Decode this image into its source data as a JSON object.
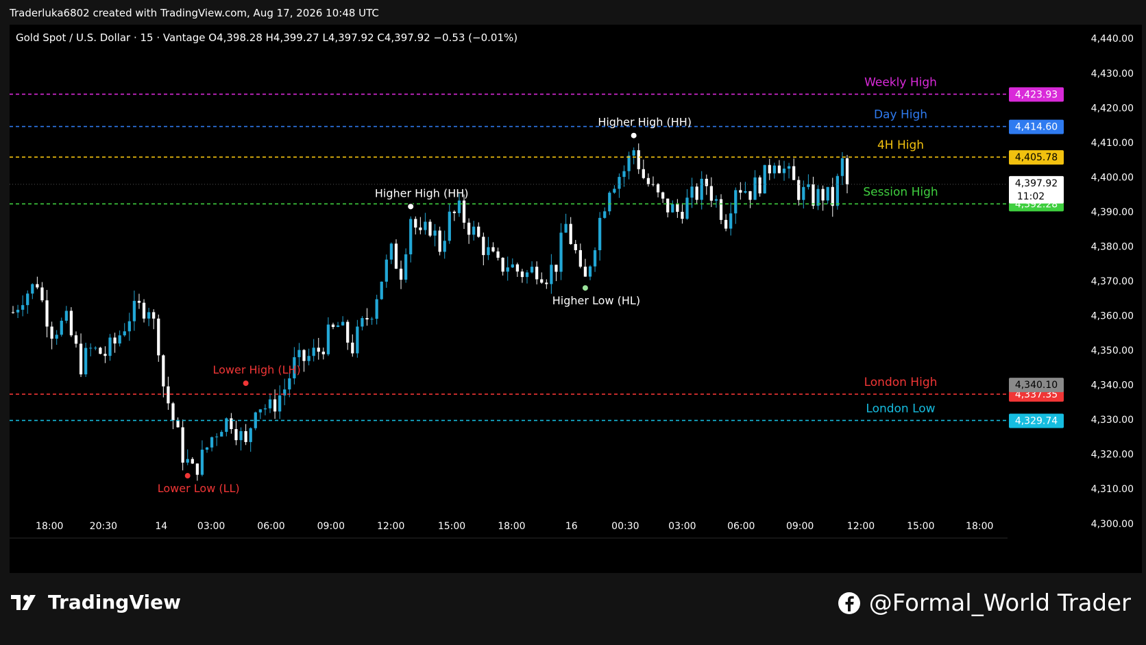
{
  "header": {
    "credit": "Traderluka6802 created with TradingView.com, Aug 17, 2026 10:48 UTC"
  },
  "chart_data": {
    "type": "candlestick",
    "title": "Gold Spot / U.S. Dollar · 15 · Vantage",
    "ohlc_text": "O4,398.28  H4,399.27  L4,397.92  C4,397.92  −0.53 (−0.01%)",
    "ylim": [
      4296,
      4444
    ],
    "y_ticks": [
      4300,
      4310,
      4320,
      4330,
      4340,
      4350,
      4360,
      4370,
      4380,
      4390,
      4400,
      4410,
      4420,
      4430,
      4440
    ],
    "y_tick_labels": [
      "4,300.00",
      "4,310.00",
      "4,320.00",
      "4,330.00",
      "4,340.00",
      "4,350.00",
      "4,360.00",
      "4,370.00",
      "4,380.00",
      "4,390.00",
      "4,400.00",
      "4,410.00",
      "4,420.00",
      "4,430.00",
      "4,440.00"
    ],
    "x_ticks": [
      "18:00",
      "20:30",
      "14",
      "03:00",
      "06:00",
      "09:00",
      "12:00",
      "15:00",
      "18:00",
      "16",
      "00:30",
      "03:00",
      "06:00",
      "09:00",
      "12:00",
      "15:00",
      "18:00"
    ],
    "x_tick_pos": [
      0.04,
      0.094,
      0.152,
      0.202,
      0.262,
      0.322,
      0.382,
      0.443,
      0.503,
      0.563,
      0.617,
      0.674,
      0.733,
      0.792,
      0.853,
      0.913,
      0.972
    ],
    "levels": [
      {
        "name": "Weekly High",
        "price": 4423.93,
        "label": "4,423.93",
        "color": "#d92ad9"
      },
      {
        "name": "Day High",
        "price": 4414.6,
        "label": "4,414.60",
        "color": "#2f7bf0"
      },
      {
        "name": "4H High",
        "price": 4405.78,
        "label": "4,405.78",
        "color": "#f2c10f"
      },
      {
        "name": "Session High",
        "price": 4392.28,
        "label": "4,392.28",
        "color": "#3fcf3f"
      },
      {
        "name": "London High",
        "price": 4337.35,
        "label": "4,337.35",
        "color": "#f03636"
      },
      {
        "name": "London Low",
        "price": 4329.74,
        "label": "4,329.74",
        "color": "#16bde0"
      }
    ],
    "extra_tag": {
      "label": "4,340.10",
      "price": 4340.1,
      "color": "#8a8a8a"
    },
    "last_price": {
      "price": 4397.92,
      "label": "4,397.92",
      "countdown": "11:02"
    },
    "annotations": [
      {
        "text": "Higher High (HH)",
        "kind": "high",
        "index": 128,
        "price": 4412.0,
        "color": "#ffffff",
        "dot": "#ffffff"
      },
      {
        "text": "Higher High (HH)",
        "kind": "high",
        "index": 82,
        "price": 4391.5,
        "color": "#ffffff",
        "dot": "#ffffff"
      },
      {
        "text": "Higher Low (HL)",
        "kind": "low",
        "index": 118,
        "price": 4368.0,
        "color": "#ffffff",
        "dot": "#9be39b"
      },
      {
        "text": "Lower High (LH)",
        "kind": "high",
        "index": 48,
        "price": 4340.5,
        "color": "#f03636",
        "dot": "#f03636"
      },
      {
        "text": "Lower Low (LL)",
        "kind": "low",
        "index": 36,
        "price": 4313.8,
        "color": "#f03636",
        "dot": "#f03636"
      }
    ],
    "candles_anchor": [
      [
        0,
        4361
      ],
      [
        2,
        4366
      ],
      [
        4,
        4368
      ],
      [
        5,
        4370
      ],
      [
        6,
        4364
      ],
      [
        8,
        4356
      ],
      [
        11,
        4358
      ],
      [
        14,
        4346
      ],
      [
        16,
        4350
      ],
      [
        19,
        4349
      ],
      [
        21,
        4352
      ],
      [
        24,
        4360
      ],
      [
        26,
        4362
      ],
      [
        28,
        4363
      ],
      [
        30,
        4352
      ],
      [
        31,
        4340
      ],
      [
        33,
        4330
      ],
      [
        35,
        4320
      ],
      [
        37,
        4315
      ],
      [
        39,
        4319
      ],
      [
        41,
        4325
      ],
      [
        43,
        4329
      ],
      [
        45,
        4330
      ],
      [
        47,
        4325
      ],
      [
        48,
        4322
      ],
      [
        50,
        4335
      ],
      [
        53,
        4333
      ],
      [
        56,
        4339
      ],
      [
        58,
        4346
      ],
      [
        61,
        4348
      ],
      [
        63,
        4350
      ],
      [
        65,
        4354
      ],
      [
        67,
        4357
      ],
      [
        70,
        4351
      ],
      [
        72,
        4357
      ],
      [
        74,
        4362
      ],
      [
        76,
        4371
      ],
      [
        78,
        4378
      ],
      [
        80,
        4373
      ],
      [
        82,
        4389
      ],
      [
        84,
        4382
      ],
      [
        86,
        4386
      ],
      [
        88,
        4380
      ],
      [
        90,
        4388
      ],
      [
        92,
        4390
      ],
      [
        94,
        4386
      ],
      [
        96,
        4382
      ],
      [
        98,
        4378
      ],
      [
        100,
        4374
      ],
      [
        102,
        4375
      ],
      [
        104,
        4373
      ],
      [
        106,
        4372
      ],
      [
        108,
        4374
      ],
      [
        110,
        4372
      ],
      [
        112,
        4375
      ],
      [
        114,
        4386
      ],
      [
        116,
        4378
      ],
      [
        117,
        4371
      ],
      [
        118,
        4370
      ],
      [
        121,
        4388
      ],
      [
        123,
        4398
      ],
      [
        126,
        4402
      ],
      [
        128,
        4408
      ],
      [
        130,
        4400
      ],
      [
        132,
        4396
      ],
      [
        134,
        4392
      ],
      [
        137,
        4390
      ],
      [
        140,
        4394
      ],
      [
        143,
        4398
      ],
      [
        145,
        4393
      ],
      [
        147,
        4388
      ],
      [
        149,
        4398
      ],
      [
        152,
        4396
      ],
      [
        155,
        4400
      ],
      [
        157,
        4406
      ],
      [
        159,
        4402
      ],
      [
        162,
        4396
      ],
      [
        165,
        4394
      ],
      [
        167,
        4395
      ],
      [
        169,
        4393
      ],
      [
        171,
        4404
      ],
      [
        172,
        4397.92
      ]
    ]
  },
  "branding": {
    "logo_text": "TradingView",
    "social_text": "@Formal_World Trader",
    "logo_icon": "tradingview-logo-icon",
    "social_icon": "facebook-icon"
  }
}
